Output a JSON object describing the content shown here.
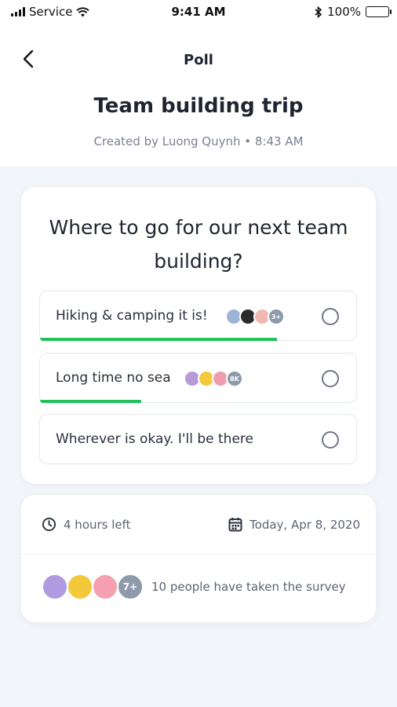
{
  "status_bar": {
    "carrier": "Service",
    "time": "9:41 AM",
    "battery": "100%"
  },
  "header": {
    "nav_title": "Poll",
    "poll_title": "Team building trip",
    "meta": "Created by Luong Quynh • 8:43 AM"
  },
  "poll": {
    "question": "Where to go for our next team building?",
    "options": [
      {
        "label": "Hiking & camping it is!",
        "progress": 0.75,
        "voter_count": "3+",
        "avatar_colors": [
          "#9db4d8",
          "#2d2a2a",
          "#f0b8b0"
        ],
        "count_color": "#8e9aab"
      },
      {
        "label": "Long time no sea",
        "progress": 0.32,
        "voter_count": "8K",
        "avatar_colors": [
          "#b89ad8",
          "#f3c83a",
          "#f09cb0"
        ],
        "count_color": "#8e9aab"
      },
      {
        "label": "Wherever is okay. I'll be there",
        "progress": 0,
        "voter_count": "",
        "avatar_colors": [],
        "count_color": "#8e9aab"
      }
    ]
  },
  "info": {
    "time_left": "4 hours left",
    "date": "Today, Apr 8, 2020",
    "people_count": "7+",
    "survey_text": "10 people have taken the survey",
    "people_colors": [
      "#b09ae0",
      "#f3c83a",
      "#f4a0b0"
    ]
  },
  "colors": {
    "progress": "#21c25a",
    "background": "#f2f5f9"
  }
}
